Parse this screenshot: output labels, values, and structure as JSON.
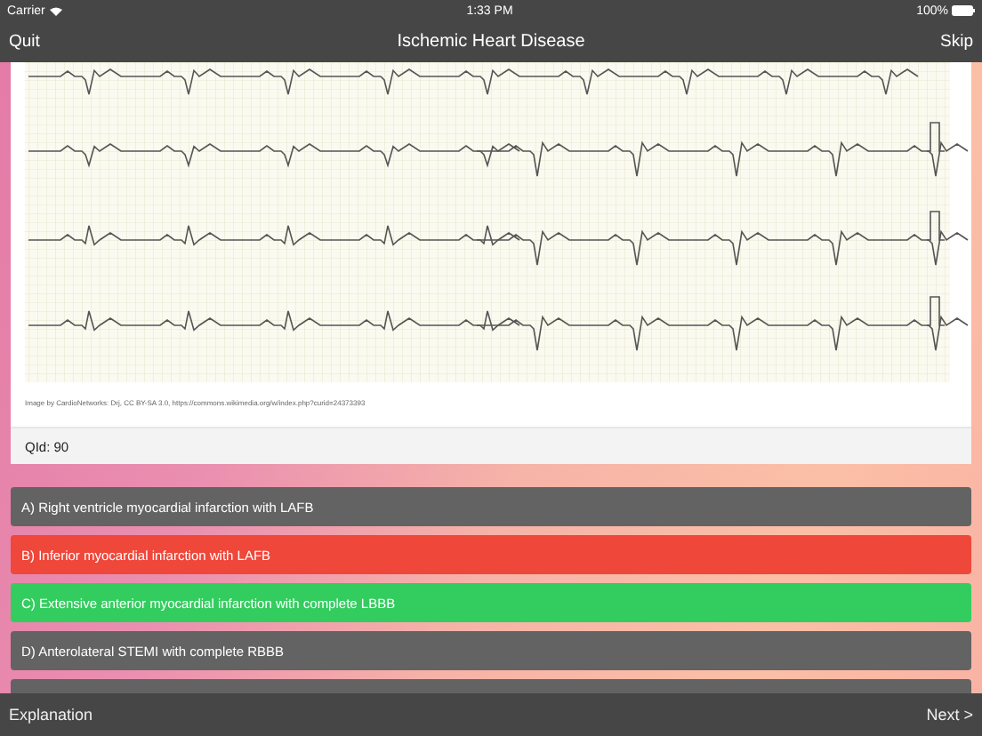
{
  "status_bar": {
    "carrier": "Carrier",
    "time": "1:33 PM",
    "battery": "100%"
  },
  "nav": {
    "left": "Quit",
    "title": "Ischemic Heart Disease",
    "right": "Skip"
  },
  "question": {
    "credit": "Image by CardioNetworks: Drj, CC BY-SA 3.0, https://commons.wikimedia.org/w/index.php?curid=24373393",
    "qid": "QId: 90"
  },
  "options": [
    {
      "label": "A) Right ventricle myocardial infarction with LAFB",
      "kind": "neutral"
    },
    {
      "label": "B) Inferior myocardial infarction with LAFB",
      "kind": "wrong"
    },
    {
      "label": "C) Extensive anterior myocardial infarction with complete LBBB",
      "kind": "correct"
    },
    {
      "label": "D) Anterolateral STEMI with complete RBBB",
      "kind": "neutral"
    },
    {
      "kind": "neutral"
    }
  ],
  "toolbar": {
    "left": "Explanation",
    "right": "Next >"
  }
}
